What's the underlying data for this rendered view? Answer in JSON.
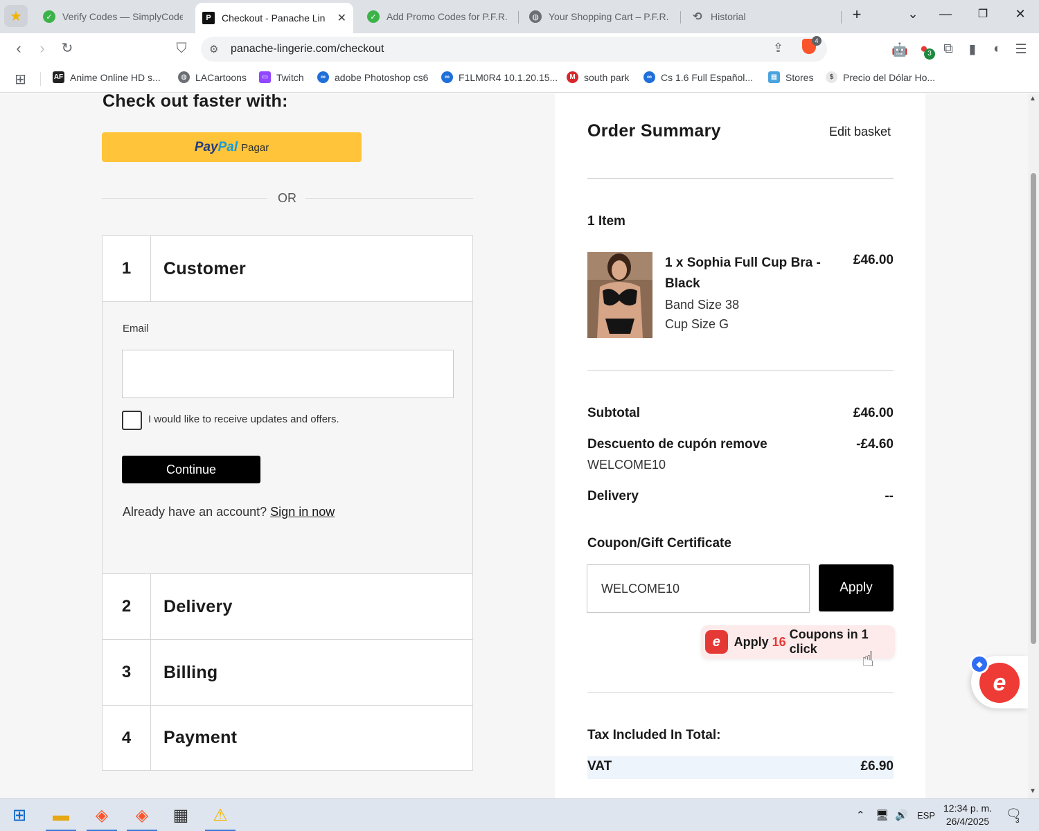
{
  "browser": {
    "tabs": [
      {
        "title": "Verify Codes — SimplyCodes",
        "active": false
      },
      {
        "title": "Checkout - Panache Lingerie",
        "active": true
      },
      {
        "title": "Add Promo Codes for P.F.R.",
        "active": false
      },
      {
        "title": "Your Shopping Cart – P.F.R.",
        "active": false
      },
      {
        "title": "Historial",
        "active": false
      }
    ],
    "url": "panache-lingerie.com/checkout",
    "brave_badge": "4",
    "extension_badge": "3",
    "bookmarks": [
      {
        "label": "Anime Online HD s...",
        "icon": "af-icon"
      },
      {
        "label": "LACartoons",
        "icon": "globe-icon"
      },
      {
        "label": "Twitch",
        "icon": "twitch-icon"
      },
      {
        "label": "adobe Photoshop cs6",
        "icon": "link-icon"
      },
      {
        "label": "F1LM0R4 10.1.20.15...",
        "icon": "link-icon"
      },
      {
        "label": "south park",
        "icon": "mega-icon"
      },
      {
        "label": "Cs 1.6 Full Español...",
        "icon": "link-icon"
      },
      {
        "label": "Stores",
        "icon": "stores-icon"
      },
      {
        "label": "Precio del Dólar Ho...",
        "icon": "dollar-icon"
      }
    ]
  },
  "checkout": {
    "faster_heading": "Check out faster with:",
    "paypal": {
      "brand_a": "Pay",
      "brand_b": "Pal",
      "label": "Pagar"
    },
    "or_text": "OR",
    "steps": [
      {
        "num": "1",
        "title": "Customer"
      },
      {
        "num": "2",
        "title": "Delivery"
      },
      {
        "num": "3",
        "title": "Billing"
      },
      {
        "num": "4",
        "title": "Payment"
      }
    ],
    "customer": {
      "email_label": "Email",
      "email_value": "",
      "updates_label": "I would like to receive updates and offers.",
      "continue_label": "Continue",
      "already_text": "Already have an account?",
      "sign_in_label": "Sign in now"
    }
  },
  "summary": {
    "title": "Order Summary",
    "edit_basket": "Edit basket",
    "item_count": "1 Item",
    "product": {
      "name": "1 x Sophia Full Cup Bra - Black",
      "price": "£46.00",
      "band": "Band Size 38",
      "cup": "Cup Size G"
    },
    "subtotal_label": "Subtotal",
    "subtotal_value": "£46.00",
    "discount_label": "Descuento de cupón",
    "discount_remove": "remove",
    "discount_value": "-£4.60",
    "discount_code": "WELCOME10",
    "delivery_label": "Delivery",
    "delivery_value": "--",
    "coupon_heading": "Coupon/Gift Certificate",
    "coupon_value": "WELCOME10",
    "apply_label": "Apply",
    "apply_coupons": {
      "pre": "Apply",
      "count": "16",
      "post": "Coupons in 1 click"
    },
    "tax_heading": "Tax Included In Total:",
    "vat_label": "VAT",
    "vat_value": "£6.90"
  },
  "taskbar": {
    "language": "ESP",
    "time": "12:34 p. m.",
    "date": "26/4/2025",
    "notifications": "3"
  },
  "colors": {
    "paypal_yellow": "#ffc439",
    "accent_red": "#e53935",
    "button_black": "#000000"
  }
}
